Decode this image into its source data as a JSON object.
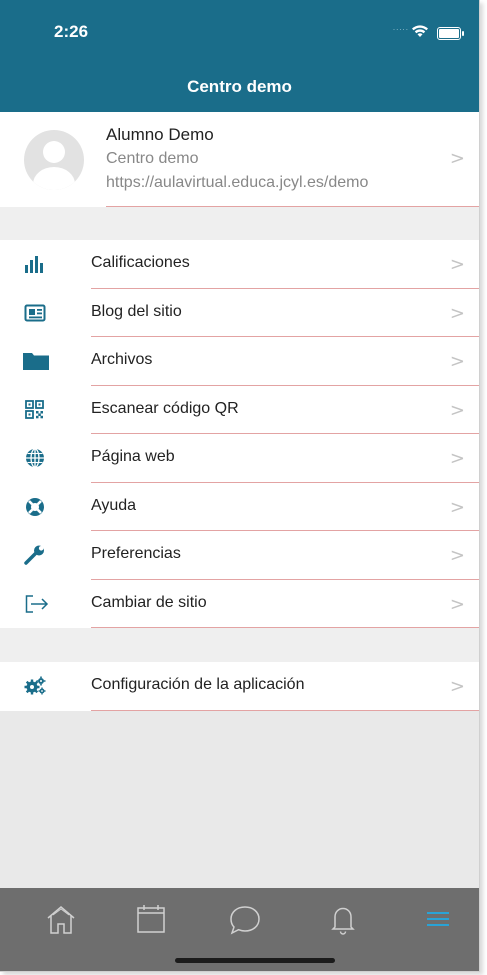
{
  "status_bar": {
    "time": "2:26",
    "signal_dots": "....."
  },
  "nav": {
    "title": "Centro demo"
  },
  "profile": {
    "name": "Alumno Demo",
    "site": "Centro demo",
    "url": "https://aulavirtual.educa.jcyl.es/demo"
  },
  "menu": {
    "items": [
      {
        "label": "Calificaciones",
        "icon": "bar-chart-icon"
      },
      {
        "label": "Blog del sitio",
        "icon": "newspaper-icon"
      },
      {
        "label": "Archivos",
        "icon": "folder-icon"
      },
      {
        "label": "Escanear código QR",
        "icon": "qr-code-icon"
      },
      {
        "label": "Página web",
        "icon": "globe-icon"
      },
      {
        "label": "Ayuda",
        "icon": "lifebuoy-icon"
      },
      {
        "label": "Preferencias",
        "icon": "wrench-icon"
      },
      {
        "label": "Cambiar de sitio",
        "icon": "sign-out-icon"
      }
    ],
    "settings": {
      "label": "Configuración de la aplicación",
      "icon": "gears-icon"
    }
  },
  "chevron": ">",
  "colors": {
    "header": "#1a6d8a",
    "icon": "#1a6d8a",
    "tab_bar": "#6e6e6e",
    "active_tab": "#29a3d6",
    "separator": "#e3a3a3"
  },
  "tabs": [
    {
      "icon": "home-icon",
      "active": false
    },
    {
      "icon": "calendar-icon",
      "active": false
    },
    {
      "icon": "chat-icon",
      "active": false
    },
    {
      "icon": "bell-icon",
      "active": false
    },
    {
      "icon": "hamburger-menu-icon",
      "active": true
    }
  ]
}
